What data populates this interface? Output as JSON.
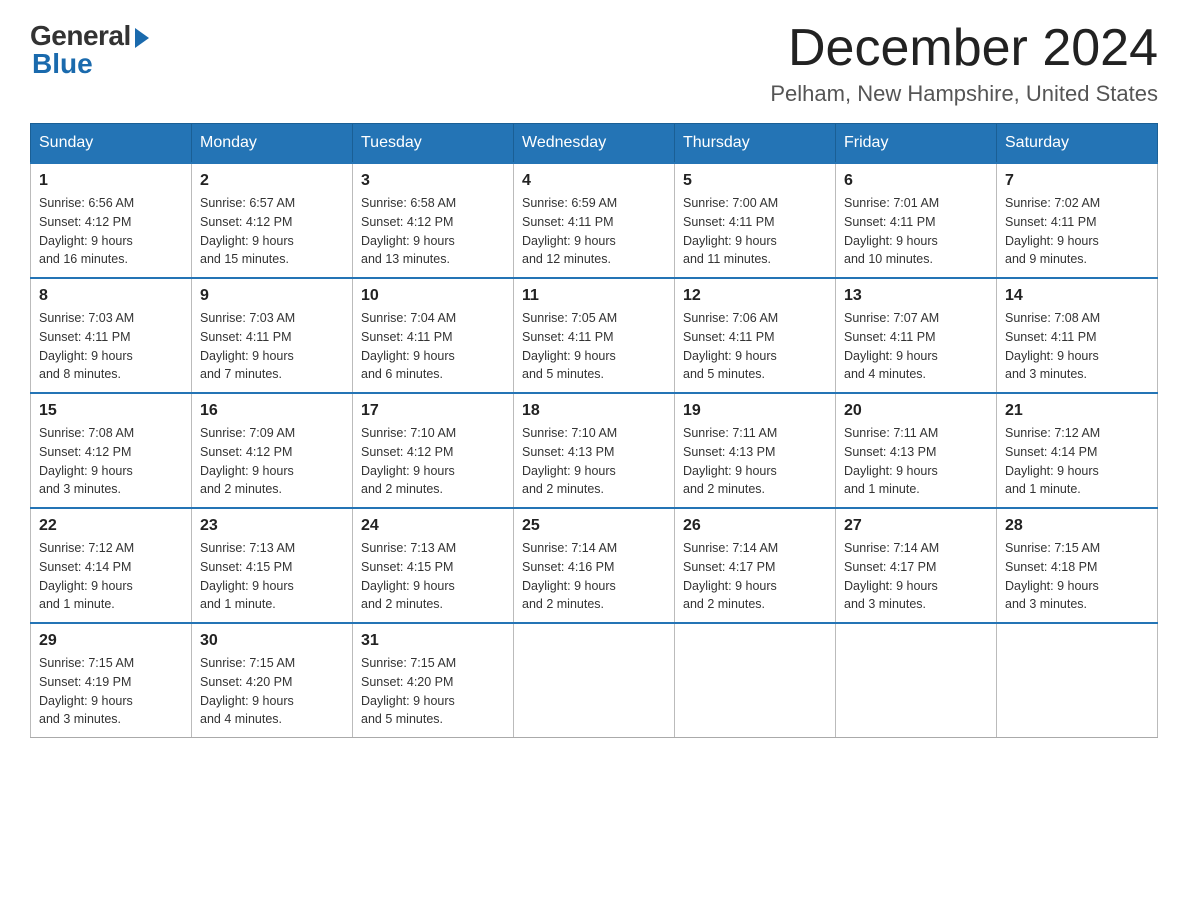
{
  "logo": {
    "general": "General",
    "blue": "Blue"
  },
  "title": {
    "month": "December 2024",
    "location": "Pelham, New Hampshire, United States"
  },
  "weekdays": [
    "Sunday",
    "Monday",
    "Tuesday",
    "Wednesday",
    "Thursday",
    "Friday",
    "Saturday"
  ],
  "weeks": [
    [
      {
        "day": "1",
        "sunrise": "6:56 AM",
        "sunset": "4:12 PM",
        "daylight": "9 hours and 16 minutes."
      },
      {
        "day": "2",
        "sunrise": "6:57 AM",
        "sunset": "4:12 PM",
        "daylight": "9 hours and 15 minutes."
      },
      {
        "day": "3",
        "sunrise": "6:58 AM",
        "sunset": "4:12 PM",
        "daylight": "9 hours and 13 minutes."
      },
      {
        "day": "4",
        "sunrise": "6:59 AM",
        "sunset": "4:11 PM",
        "daylight": "9 hours and 12 minutes."
      },
      {
        "day": "5",
        "sunrise": "7:00 AM",
        "sunset": "4:11 PM",
        "daylight": "9 hours and 11 minutes."
      },
      {
        "day": "6",
        "sunrise": "7:01 AM",
        "sunset": "4:11 PM",
        "daylight": "9 hours and 10 minutes."
      },
      {
        "day": "7",
        "sunrise": "7:02 AM",
        "sunset": "4:11 PM",
        "daylight": "9 hours and 9 minutes."
      }
    ],
    [
      {
        "day": "8",
        "sunrise": "7:03 AM",
        "sunset": "4:11 PM",
        "daylight": "9 hours and 8 minutes."
      },
      {
        "day": "9",
        "sunrise": "7:03 AM",
        "sunset": "4:11 PM",
        "daylight": "9 hours and 7 minutes."
      },
      {
        "day": "10",
        "sunrise": "7:04 AM",
        "sunset": "4:11 PM",
        "daylight": "9 hours and 6 minutes."
      },
      {
        "day": "11",
        "sunrise": "7:05 AM",
        "sunset": "4:11 PM",
        "daylight": "9 hours and 5 minutes."
      },
      {
        "day": "12",
        "sunrise": "7:06 AM",
        "sunset": "4:11 PM",
        "daylight": "9 hours and 5 minutes."
      },
      {
        "day": "13",
        "sunrise": "7:07 AM",
        "sunset": "4:11 PM",
        "daylight": "9 hours and 4 minutes."
      },
      {
        "day": "14",
        "sunrise": "7:08 AM",
        "sunset": "4:11 PM",
        "daylight": "9 hours and 3 minutes."
      }
    ],
    [
      {
        "day": "15",
        "sunrise": "7:08 AM",
        "sunset": "4:12 PM",
        "daylight": "9 hours and 3 minutes."
      },
      {
        "day": "16",
        "sunrise": "7:09 AM",
        "sunset": "4:12 PM",
        "daylight": "9 hours and 2 minutes."
      },
      {
        "day": "17",
        "sunrise": "7:10 AM",
        "sunset": "4:12 PM",
        "daylight": "9 hours and 2 minutes."
      },
      {
        "day": "18",
        "sunrise": "7:10 AM",
        "sunset": "4:13 PM",
        "daylight": "9 hours and 2 minutes."
      },
      {
        "day": "19",
        "sunrise": "7:11 AM",
        "sunset": "4:13 PM",
        "daylight": "9 hours and 2 minutes."
      },
      {
        "day": "20",
        "sunrise": "7:11 AM",
        "sunset": "4:13 PM",
        "daylight": "9 hours and 1 minute."
      },
      {
        "day": "21",
        "sunrise": "7:12 AM",
        "sunset": "4:14 PM",
        "daylight": "9 hours and 1 minute."
      }
    ],
    [
      {
        "day": "22",
        "sunrise": "7:12 AM",
        "sunset": "4:14 PM",
        "daylight": "9 hours and 1 minute."
      },
      {
        "day": "23",
        "sunrise": "7:13 AM",
        "sunset": "4:15 PM",
        "daylight": "9 hours and 1 minute."
      },
      {
        "day": "24",
        "sunrise": "7:13 AM",
        "sunset": "4:15 PM",
        "daylight": "9 hours and 2 minutes."
      },
      {
        "day": "25",
        "sunrise": "7:14 AM",
        "sunset": "4:16 PM",
        "daylight": "9 hours and 2 minutes."
      },
      {
        "day": "26",
        "sunrise": "7:14 AM",
        "sunset": "4:17 PM",
        "daylight": "9 hours and 2 minutes."
      },
      {
        "day": "27",
        "sunrise": "7:14 AM",
        "sunset": "4:17 PM",
        "daylight": "9 hours and 3 minutes."
      },
      {
        "day": "28",
        "sunrise": "7:15 AM",
        "sunset": "4:18 PM",
        "daylight": "9 hours and 3 minutes."
      }
    ],
    [
      {
        "day": "29",
        "sunrise": "7:15 AM",
        "sunset": "4:19 PM",
        "daylight": "9 hours and 3 minutes."
      },
      {
        "day": "30",
        "sunrise": "7:15 AM",
        "sunset": "4:20 PM",
        "daylight": "9 hours and 4 minutes."
      },
      {
        "day": "31",
        "sunrise": "7:15 AM",
        "sunset": "4:20 PM",
        "daylight": "9 hours and 5 minutes."
      },
      null,
      null,
      null,
      null
    ]
  ],
  "labels": {
    "sunrise": "Sunrise:",
    "sunset": "Sunset:",
    "daylight": "Daylight:"
  }
}
